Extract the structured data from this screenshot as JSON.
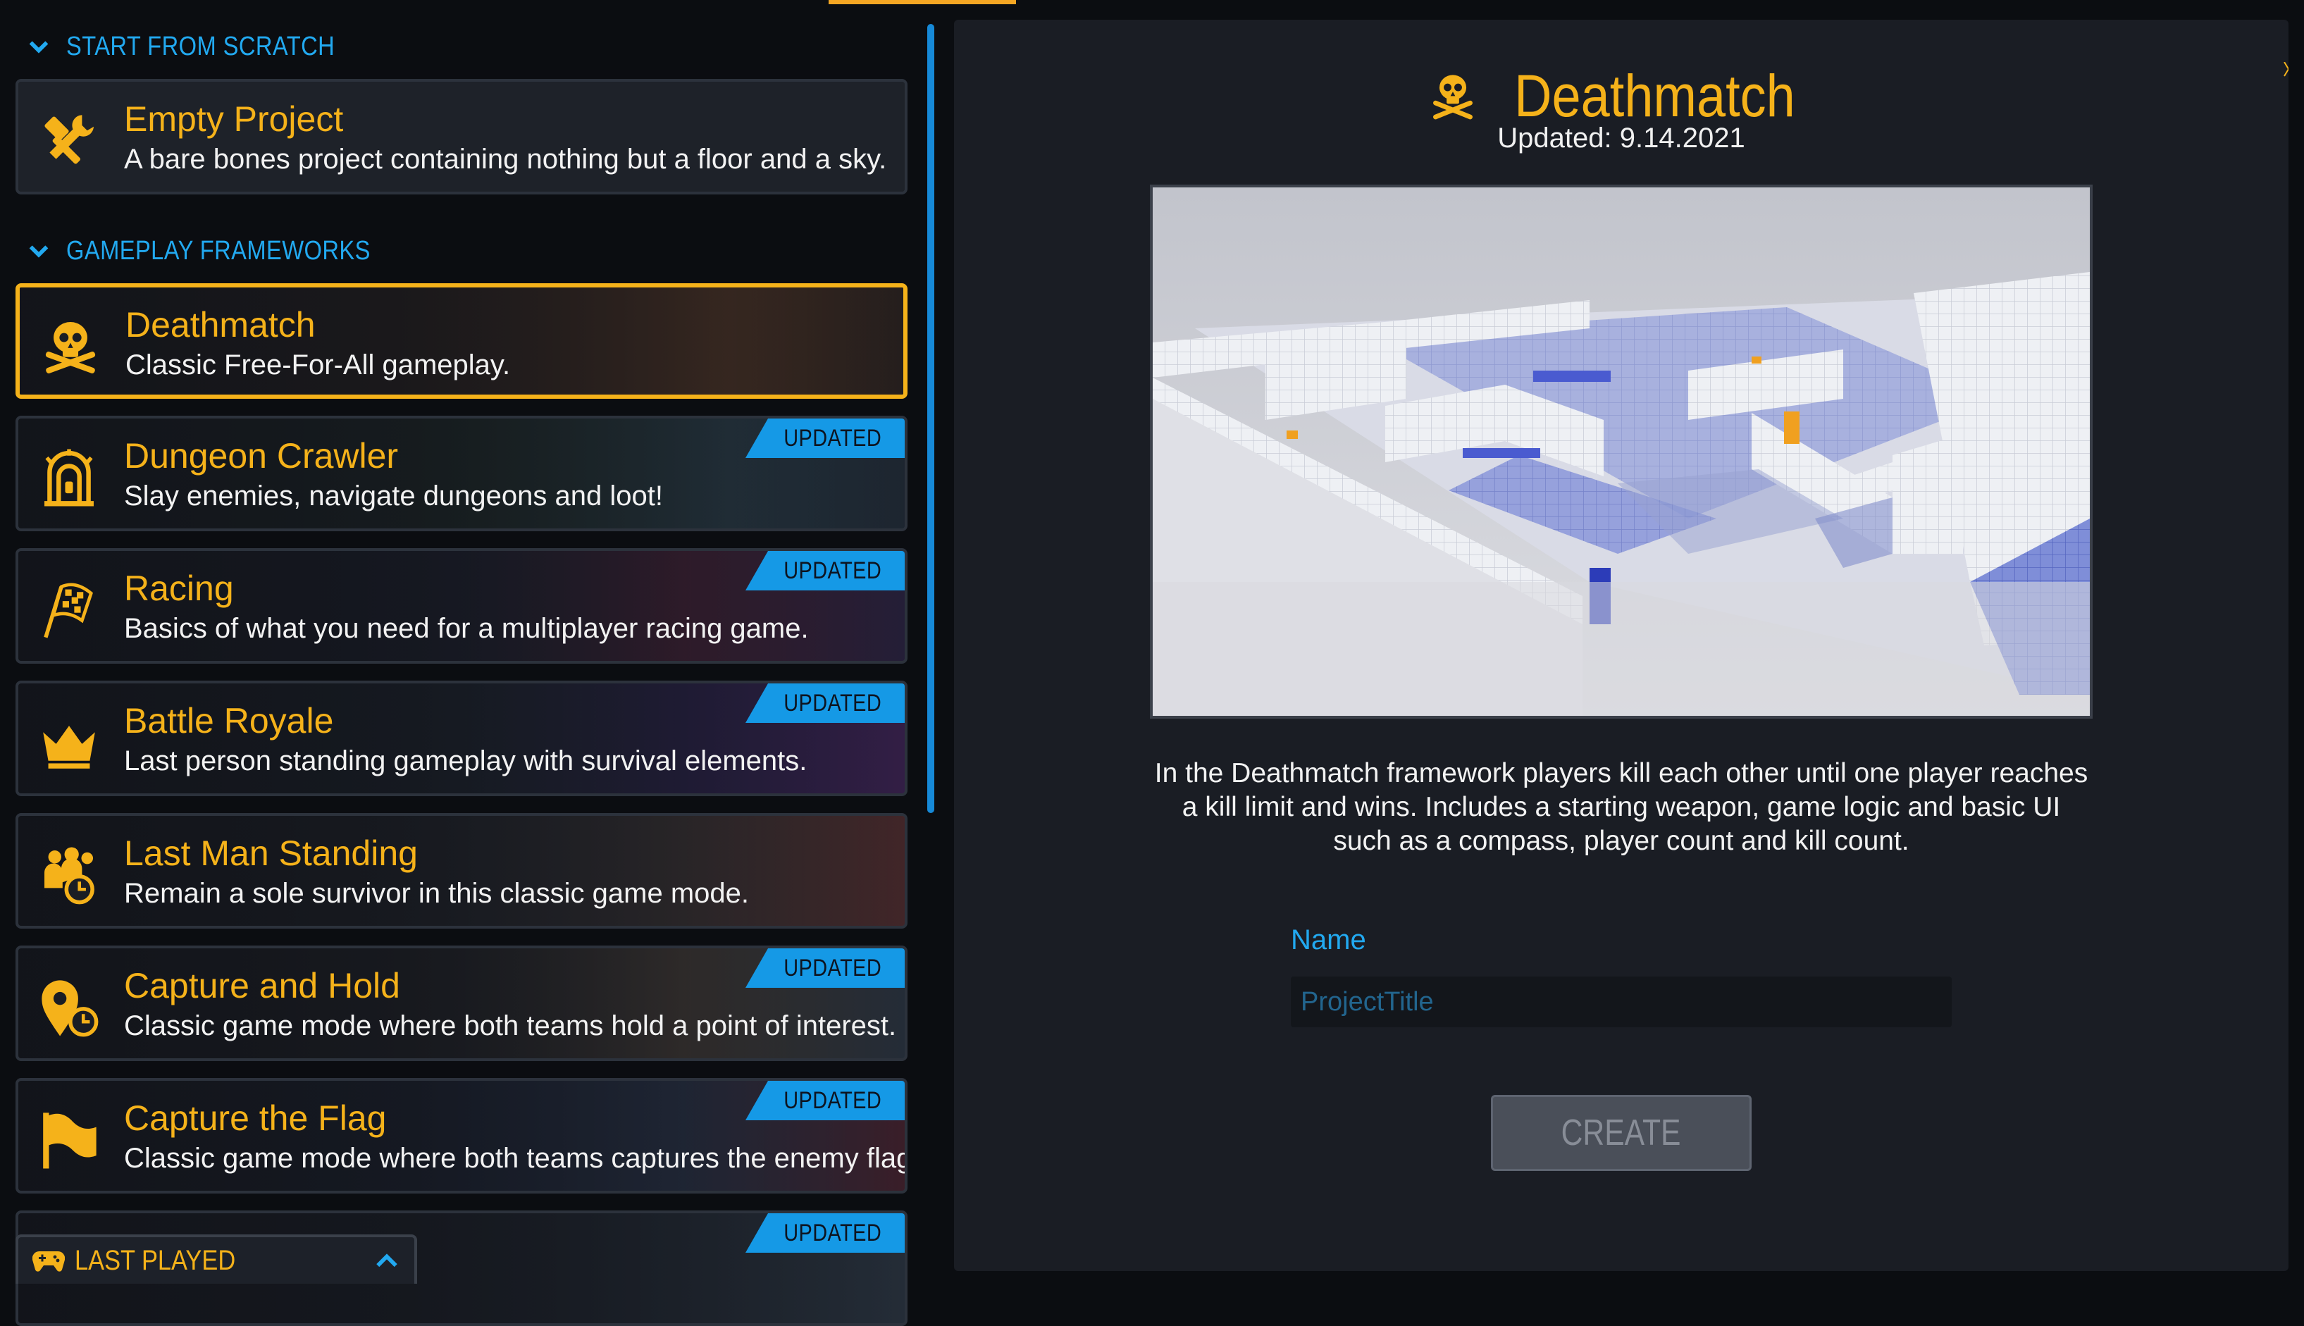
{
  "sections": {
    "scratch_label": "START FROM SCRATCH",
    "frameworks_label": "GAMEPLAY FRAMEWORKS"
  },
  "templates": [
    {
      "icon": "hammer-wrench-icon",
      "title": "Empty Project",
      "desc": "A bare bones project containing nothing but a floor and a sky.",
      "badge": ""
    },
    {
      "icon": "skull-crossbones-icon",
      "title": "Deathmatch",
      "desc": "Classic Free-For-All gameplay.",
      "badge": "",
      "selected": true
    },
    {
      "icon": "dungeon-door-icon",
      "title": "Dungeon Crawler",
      "desc": "Slay enemies, navigate dungeons and loot!",
      "badge": "UPDATED"
    },
    {
      "icon": "checkered-flag-icon",
      "title": "Racing",
      "desc": "Basics of what you need for a multiplayer racing game.",
      "badge": "UPDATED"
    },
    {
      "icon": "crown-icon",
      "title": "Battle Royale",
      "desc": "Last person standing gameplay with survival elements.",
      "badge": "UPDATED"
    },
    {
      "icon": "group-clock-icon",
      "title": "Last Man Standing",
      "desc": "Remain a sole survivor in this classic game mode.",
      "badge": ""
    },
    {
      "icon": "location-clock-icon",
      "title": "Capture and Hold",
      "desc": "Classic game mode where both teams hold a point of interest.",
      "badge": "UPDATED"
    },
    {
      "icon": "flag-icon",
      "title": "Capture the Flag",
      "desc": "Classic game mode where both teams captures the enemy flags.",
      "badge": "UPDATED"
    },
    {
      "icon": "",
      "title": "",
      "desc": "",
      "badge": "UPDATED"
    }
  ],
  "last_played": {
    "label": "LAST PLAYED",
    "icon": "gamepad-icon",
    "toggle_icon": "chevron-up-icon"
  },
  "detail": {
    "icon": "skull-crossbones-icon",
    "title": "Deathmatch",
    "updated": "Updated: 9.14.2021",
    "description": "In the Deathmatch framework players kill each other until one player reaches a kill limit and wins. Includes a starting weapon, game logic and basic UI such as a compass, player count and kill count.",
    "name_label": "Name",
    "name_value": "",
    "name_placeholder": "ProjectTitle",
    "create_label": "CREATE"
  },
  "colors": {
    "accent": "#f5b21a",
    "blue": "#22a9f0",
    "badge": "#1599e6",
    "panel": "#1a1d24",
    "background": "#0b0d11"
  }
}
